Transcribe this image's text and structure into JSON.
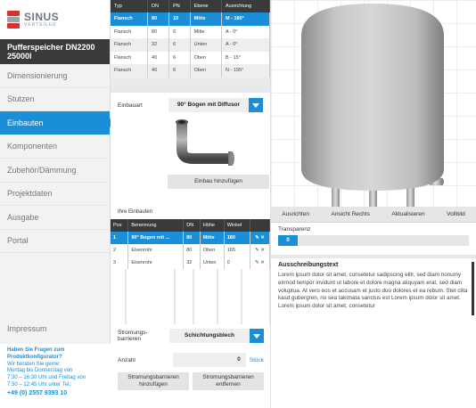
{
  "brand": {
    "name": "SINUS",
    "sub": "VERTEILER"
  },
  "product": {
    "line1": "Pufferspeicher DN2200",
    "line2": "25000l"
  },
  "nav": [
    {
      "label": "Dimensionierung",
      "active": false
    },
    {
      "label": "Stutzen",
      "active": false
    },
    {
      "label": "Einbauten",
      "active": true
    },
    {
      "label": "Komponenten",
      "active": false
    },
    {
      "label": "Zubehör/Dämmung",
      "active": false
    },
    {
      "label": "Projektdaten",
      "active": false
    },
    {
      "label": "Ausgabe",
      "active": false
    },
    {
      "label": "Portal",
      "active": false
    }
  ],
  "impressum": "Impressum",
  "help": {
    "question": "Haben Sie Fragen zum Produktkonfigurator?",
    "text1": "Wir beraten Sie gerne:",
    "text2": "Montag bis Donnerstag von",
    "text3": "7:30 – 16:30 Uhr und Freitag von",
    "text4": "7:30 – 12:45 Uhr unter Tel.:",
    "phone": "+49 (0) 2557 9393 10"
  },
  "stutzen_table": {
    "headers": [
      "Typ",
      "DN",
      "PN",
      "Ebene",
      "Ausrichtung"
    ],
    "rows": [
      [
        "Flansch",
        "80",
        "10",
        "Mitte",
        "M - 180°"
      ],
      [
        "Flansch",
        "80",
        "6",
        "Mitte",
        "A - 0°"
      ],
      [
        "Flansch",
        "32",
        "6",
        "Unten",
        "A - 0°"
      ],
      [
        "Flansch",
        "40",
        "6",
        "Oben",
        "B - 15°"
      ],
      [
        "Flansch",
        "40",
        "6",
        "Oben",
        "N - 195°"
      ]
    ]
  },
  "einbau": {
    "label": "Einbauart",
    "value": "90° Bogen mit Diffusor",
    "add_button": "Einbau hinzufügen"
  },
  "ihre_einbauten": {
    "title": "Ihre Einbauten",
    "headers": [
      "Pos",
      "Benennung",
      "DN",
      "Höhe",
      "Winkel",
      ""
    ],
    "rows": [
      [
        "1",
        "90° Bogen mit ...",
        "80",
        "Mitte",
        "180"
      ],
      [
        "2",
        "Eisenrohr",
        "80",
        "Oben",
        "165"
      ],
      [
        "3",
        "Eisenrohr",
        "32",
        "Unten",
        "0"
      ]
    ]
  },
  "stroemung": {
    "label1": "Stromungs-",
    "label2": "barrieren",
    "value": "Schichtungsblech",
    "anzahl_label": "Anzahl",
    "anzahl_value": "0",
    "unit": "Stück",
    "add_line1": "Stromungsbarrieren",
    "add_line2": "hinzufügen",
    "remove_line1": "Stromungsbarrieren",
    "remove_line2": "entfernen"
  },
  "view_buttons": [
    "Ausrichten",
    "Ansicht Rechts",
    "Aktualisieren",
    "Vollbild"
  ],
  "transparency": {
    "label": "Transparenz",
    "value": "0"
  },
  "ausschreibung": {
    "title": "Ausschreibungstext",
    "text": "Lorem ipsum dolor sit amet, consetetur sadipscing elitr, sed diam nonumy eirmod tempor invidunt ut labore et dolore magna aliquyam erat, sed diam voluptua. At vero eos et accusam et justo duo dolores et ea rebum. Stet clita kasd gubergren, no sea takimata sanctus est Lorem ipsum dolor sit amet. Lorem ipsum dolor sit amet, consetetur"
  },
  "colors": {
    "accent": "#1a8ed6",
    "dark": "#3a3a3a",
    "brand_red": "#d9302c"
  }
}
